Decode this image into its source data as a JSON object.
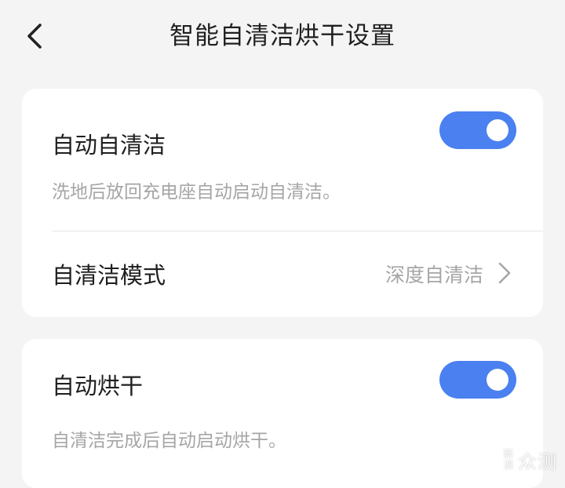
{
  "header": {
    "title": "智能自清洁烘干设置",
    "back_icon": "chevron-left-icon"
  },
  "self_clean_card": {
    "auto_clean_title": "自动自清洁",
    "auto_clean_desc": "洗地后放回充电座自动启动自清洁。",
    "auto_clean_enabled": true,
    "mode_title": "自清洁模式",
    "mode_value": "深度自清洁",
    "mode_icon": "chevron-right-icon"
  },
  "dry_card": {
    "auto_dry_title": "自动烘干",
    "auto_dry_desc": "自清洁完成后自动启动烘干。",
    "auto_dry_enabled": true
  },
  "watermark": {
    "badge": "新浪",
    "text": "众测"
  },
  "colors": {
    "accent": "#4a80f0",
    "background": "#f4f4f4",
    "card": "#ffffff",
    "primary_text": "#1f1f1f",
    "secondary_text": "#a6a6a6"
  }
}
